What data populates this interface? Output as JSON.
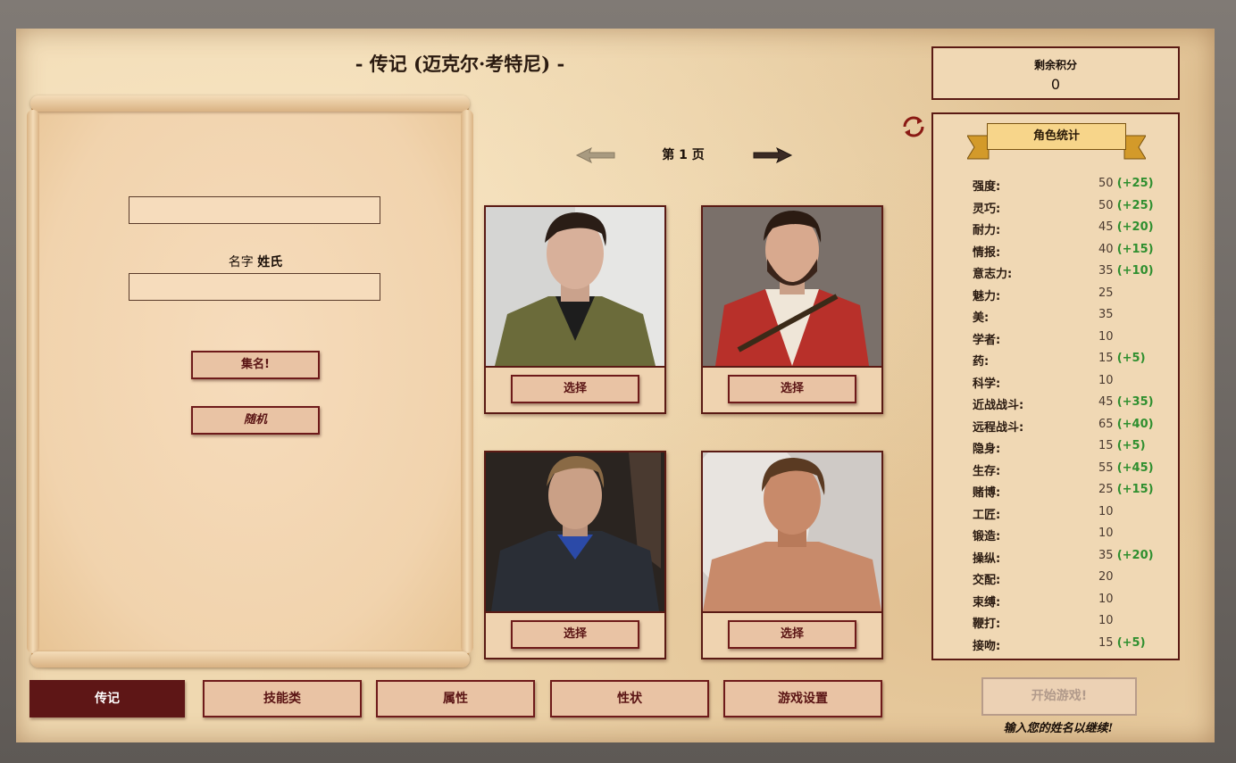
{
  "title": "- 传记 (迈克尔·考特尼) -",
  "name_panel": {
    "first_name_value": "",
    "name_label_first": "名字",
    "name_label_last": "姓氏",
    "last_name_value": "",
    "set_name_button": "集名!",
    "random_button": "随机"
  },
  "pager": {
    "label": "第 1 页",
    "prev_icon": "arrow-left-icon",
    "next_icon": "arrow-right-icon"
  },
  "portraits": [
    {
      "select_label": "选择",
      "hair": "#2a1d16",
      "skin": "#d8b09a",
      "outfit": "#6b6b3a",
      "bg": "#d9d9d9"
    },
    {
      "select_label": "选择",
      "hair": "#2b1b12",
      "skin": "#d8a98e",
      "outfit": "#b8302a",
      "bg": "#7a706a"
    },
    {
      "select_label": "选择",
      "hair": "#8a6a45",
      "skin": "#caa086",
      "outfit": "#2a2e36",
      "bg": "#2a2420"
    },
    {
      "select_label": "选择",
      "hair": "#5a3a22",
      "skin": "#c88a6a",
      "outfit": "#c88a6a",
      "bg": "#cfcac6"
    }
  ],
  "points": {
    "label": "剩余积分",
    "value": "0"
  },
  "stats_title": "角色统计",
  "stats": [
    {
      "name": "强度:",
      "value": "50",
      "bonus": "(+25)"
    },
    {
      "name": "灵巧:",
      "value": "50",
      "bonus": "(+25)"
    },
    {
      "name": "耐力:",
      "value": "45",
      "bonus": "(+20)"
    },
    {
      "name": "情报:",
      "value": "40",
      "bonus": "(+15)"
    },
    {
      "name": "意志力:",
      "value": "35",
      "bonus": "(+10)"
    },
    {
      "name": "魅力:",
      "value": "25",
      "bonus": ""
    },
    {
      "name": "美:",
      "value": "35",
      "bonus": ""
    },
    {
      "name": "学者:",
      "value": "10",
      "bonus": ""
    },
    {
      "name": "药:",
      "value": "15",
      "bonus": "(+5)"
    },
    {
      "name": "科学:",
      "value": "10",
      "bonus": ""
    },
    {
      "name": "近战战斗:",
      "value": "45",
      "bonus": "(+35)"
    },
    {
      "name": "远程战斗:",
      "value": "65",
      "bonus": "(+40)"
    },
    {
      "name": "隐身:",
      "value": "15",
      "bonus": "(+5)"
    },
    {
      "name": "生存:",
      "value": "55",
      "bonus": "(+45)"
    },
    {
      "name": "赌博:",
      "value": "25",
      "bonus": "(+15)"
    },
    {
      "name": "工匠:",
      "value": "10",
      "bonus": ""
    },
    {
      "name": "锻造:",
      "value": "10",
      "bonus": ""
    },
    {
      "name": "操纵:",
      "value": "35",
      "bonus": "(+20)"
    },
    {
      "name": "交配:",
      "value": "20",
      "bonus": ""
    },
    {
      "name": "束缚:",
      "value": "10",
      "bonus": ""
    },
    {
      "name": "鞭打:",
      "value": "10",
      "bonus": ""
    },
    {
      "name": "接吻:",
      "value": "15",
      "bonus": "(+5)"
    }
  ],
  "tabs": [
    {
      "label": "传记",
      "active": true
    },
    {
      "label": "技能类",
      "active": false
    },
    {
      "label": "属性",
      "active": false
    },
    {
      "label": "性状",
      "active": false
    },
    {
      "label": "游戏设置",
      "active": false
    }
  ],
  "start_button": "开始游戏!",
  "hint": "输入您的姓名以继续!",
  "colors": {
    "accent": "#5e1616",
    "bonus": "#2f8f2f",
    "parchment": "#efd8b0"
  }
}
